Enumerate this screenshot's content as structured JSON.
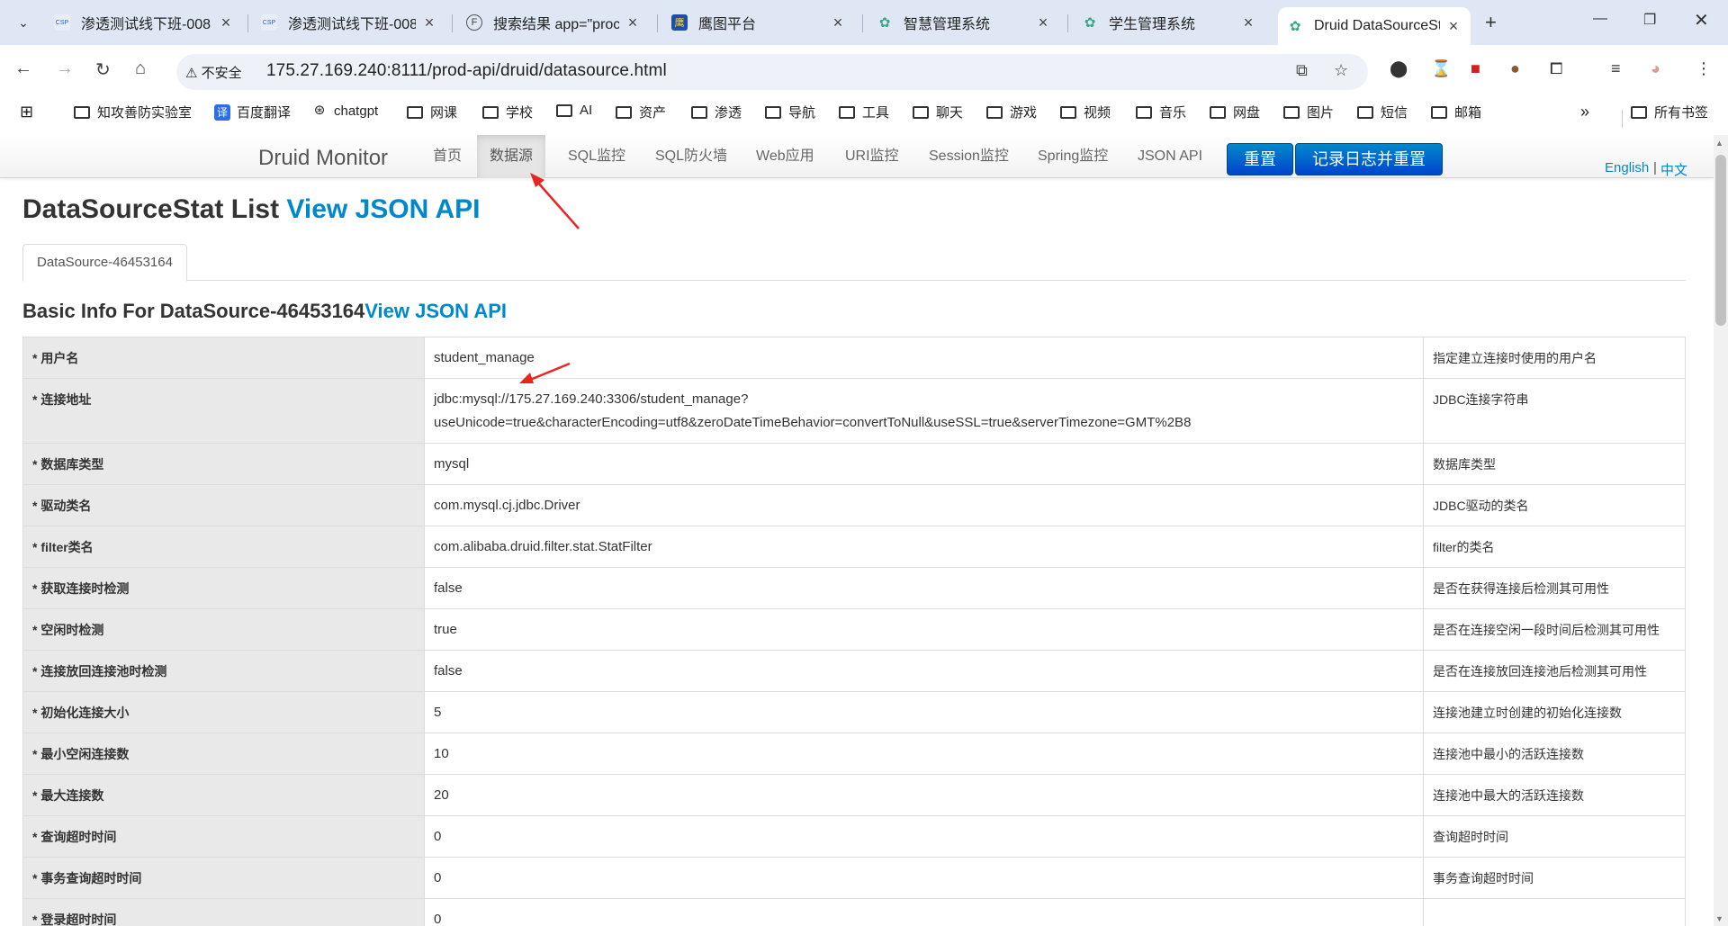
{
  "browser": {
    "tabs": [
      {
        "title": "渗透测试线下班-008",
        "fav": "CSP"
      },
      {
        "title": "渗透测试线下班-008",
        "fav": "CSP"
      },
      {
        "title": "搜索结果 app=\"proc",
        "fav": "F"
      },
      {
        "title": "鹰图平台",
        "fav": "鹰"
      },
      {
        "title": "智慧管理系统",
        "fav": "✿"
      },
      {
        "title": "学生管理系统",
        "fav": "✿"
      },
      {
        "title": "Druid DataSourceSt",
        "fav": "✿"
      }
    ],
    "new_tab": "+",
    "omnibox": {
      "security": "不安全",
      "url": "175.27.169.240:8111/prod-api/druid/datasource.html"
    },
    "bookmarks": [
      {
        "label": "知攻善防实验室",
        "type": "folder"
      },
      {
        "label": "百度翻译",
        "type": "site",
        "fav": "译"
      },
      {
        "label": "chatgpt",
        "type": "site",
        "fav": "⊛"
      },
      {
        "label": "网课",
        "type": "folder"
      },
      {
        "label": "学校",
        "type": "folder"
      },
      {
        "label": "AI",
        "type": "folder"
      },
      {
        "label": "资产",
        "type": "folder"
      },
      {
        "label": "渗透",
        "type": "folder"
      },
      {
        "label": "导航",
        "type": "folder"
      },
      {
        "label": "工具",
        "type": "folder"
      },
      {
        "label": "聊天",
        "type": "folder"
      },
      {
        "label": "游戏",
        "type": "folder"
      },
      {
        "label": "视频",
        "type": "folder"
      },
      {
        "label": "音乐",
        "type": "folder"
      },
      {
        "label": "网盘",
        "type": "folder"
      },
      {
        "label": "图片",
        "type": "folder"
      },
      {
        "label": "短信",
        "type": "folder"
      },
      {
        "label": "邮箱",
        "type": "folder"
      }
    ],
    "bookmarks_overflow": "»",
    "all_bookmarks": "所有书签"
  },
  "druid": {
    "brand": "Druid Monitor",
    "nav": [
      "首页",
      "数据源",
      "SQL监控",
      "SQL防火墙",
      "Web应用",
      "URI监控",
      "Session监控",
      "Spring监控",
      "JSON API"
    ],
    "active_nav": "数据源",
    "reset_button": "重置",
    "log_reset_button": "记录日志并重置",
    "lang_en": "English",
    "lang_sep": "|",
    "lang_zh": "中文",
    "title_text": "DataSourceStat List ",
    "title_link": "View JSON API",
    "datasource_tab": "DataSource-46453164",
    "basic_info_text": "Basic Info For DataSource-46453164",
    "basic_info_link": "View JSON API",
    "rows": [
      {
        "key": "* 用户名",
        "value": "student_manage",
        "desc": "指定建立连接时使用的用户名"
      },
      {
        "key": "* 连接地址",
        "value": "jdbc:mysql://175.27.169.240:3306/student_manage?\nuseUnicode=true&characterEncoding=utf8&zeroDateTimeBehavior=convertToNull&useSSL=true&serverTimezone=GMT%2B8",
        "desc": "JDBC连接字符串"
      },
      {
        "key": "* 数据库类型",
        "value": "mysql",
        "desc": "数据库类型"
      },
      {
        "key": "* 驱动类名",
        "value": "com.mysql.cj.jdbc.Driver",
        "desc": "JDBC驱动的类名"
      },
      {
        "key": "* filter类名",
        "value": "com.alibaba.druid.filter.stat.StatFilter",
        "desc": "filter的类名"
      },
      {
        "key": "* 获取连接时检测",
        "value": "false",
        "desc": "是否在获得连接后检测其可用性"
      },
      {
        "key": "* 空闲时检测",
        "value": "true",
        "desc": "是否在连接空闲一段时间后检测其可用性"
      },
      {
        "key": "* 连接放回连接池时检测",
        "value": "false",
        "desc": "是否在连接放回连接池后检测其可用性"
      },
      {
        "key": "* 初始化连接大小",
        "value": "5",
        "desc": "连接池建立时创建的初始化连接数"
      },
      {
        "key": "* 最小空闲连接数",
        "value": "10",
        "desc": "连接池中最小的活跃连接数"
      },
      {
        "key": "* 最大连接数",
        "value": "20",
        "desc": "连接池中最大的活跃连接数"
      },
      {
        "key": "* 查询超时时间",
        "value": "0",
        "desc": "查询超时时间"
      },
      {
        "key": "* 事务查询超时时间",
        "value": "0",
        "desc": "事务查询超时时间"
      },
      {
        "key": "* 登录超时时间",
        "value": "0",
        "desc": ""
      }
    ]
  },
  "colors": {
    "link": "#0088cc",
    "annotation_arrow": "#e8251f",
    "tabbar": "#dfe7f5"
  }
}
